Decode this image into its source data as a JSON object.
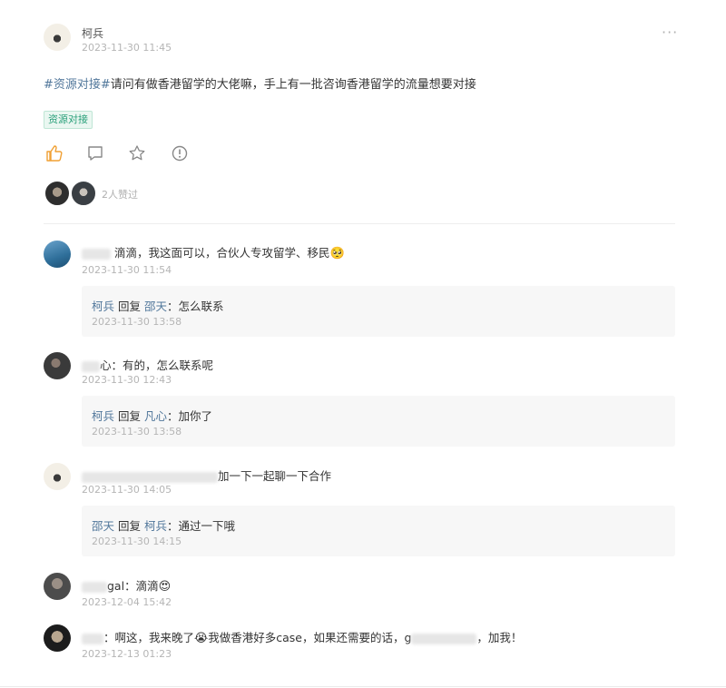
{
  "post": {
    "author": "柯兵",
    "time": "2023-11-30 11:45",
    "more_icon": "···",
    "hashtag": "#资源对接#",
    "content": "请问有做香港留学的大佬嘛，手上有一批咨询香港留学的流量想要对接",
    "tag": "资源对接",
    "likers_text": "2人赞过"
  },
  "colors": {
    "link": "#51779b",
    "tag": "#2aa07a",
    "like": "#f0a034"
  },
  "comments": [
    {
      "text": "滴滴，我这面可以，合伙人专攻留学、移民",
      "emoji": "🥺",
      "time": "2023-11-30 11:54"
    },
    {
      "name_tail": "心",
      "text": "：有的，怎么联系呢",
      "time": "2023-11-30 12:43"
    },
    {
      "name_head": "柯兵",
      "text": "加一下一起聊一下合作",
      "time": "2023-11-30 14:05"
    },
    {
      "name_tail": "gal",
      "text": "：滴滴",
      "emoji": "😍",
      "time": "2023-12-04 15:42"
    },
    {
      "text_a": "：啊这，我来晚了",
      "emoji": "😭",
      "text_b": "我做香港好多case，如果还需要的话，g",
      "text_c": "，加我！",
      "time": "2023-12-13 01:23"
    }
  ],
  "replies": [
    {
      "from": "柯兵",
      "verb": "回复",
      "to": "邵天",
      "text": "：怎么联系",
      "time": "2023-11-30 13:58"
    },
    {
      "from": "柯兵",
      "verb": "回复",
      "to": "凡心",
      "text": "：加你了",
      "time": "2023-11-30 13:58"
    },
    {
      "from": "邵天",
      "verb": "回复",
      "to": "柯兵",
      "text": "：通过一下哦",
      "time": "2023-11-30 14:15"
    }
  ]
}
